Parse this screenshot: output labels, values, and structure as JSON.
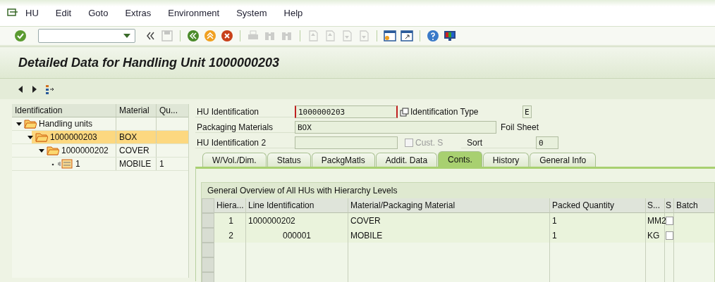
{
  "menu": [
    "HU",
    "Edit",
    "Goto",
    "Extras",
    "Environment",
    "System",
    "Help"
  ],
  "toolbar": [
    {
      "kind": "enter",
      "disabled": false
    },
    {
      "kind": "command-field"
    },
    {
      "kind": "collapse",
      "disabled": false
    },
    {
      "kind": "save",
      "disabled": true
    },
    {
      "kind": "sep"
    },
    {
      "kind": "back",
      "disabled": false
    },
    {
      "kind": "exit",
      "disabled": false
    },
    {
      "kind": "cancel",
      "disabled": false
    },
    {
      "kind": "sep"
    },
    {
      "kind": "print",
      "disabled": true
    },
    {
      "kind": "find",
      "disabled": true
    },
    {
      "kind": "find-next",
      "disabled": true
    },
    {
      "kind": "sep"
    },
    {
      "kind": "page-first",
      "disabled": true
    },
    {
      "kind": "page-up",
      "disabled": true
    },
    {
      "kind": "page-down",
      "disabled": true
    },
    {
      "kind": "page-last",
      "disabled": true
    },
    {
      "kind": "sep"
    },
    {
      "kind": "new-window",
      "disabled": false
    },
    {
      "kind": "shortcut",
      "disabled": false
    },
    {
      "kind": "sep"
    },
    {
      "kind": "help",
      "disabled": false
    },
    {
      "kind": "layout",
      "disabled": false
    }
  ],
  "title": "Detailed Data for Handling Unit 1000000203",
  "tree": {
    "columns": [
      "Identification",
      "Material",
      "Qu..."
    ],
    "nodes": [
      {
        "kind": "folder",
        "id": "Handling units",
        "selected": false,
        "expanded": true,
        "children": [
          {
            "kind": "folder",
            "id": "1000000203",
            "material": "BOX",
            "selected": true,
            "expanded": true,
            "children": [
              {
                "kind": "folder",
                "id": "1000000202",
                "material": "COVER",
                "selected": false,
                "expanded": true,
                "children": [
                  {
                    "kind": "item",
                    "id": "1",
                    "material": "MOBILE",
                    "quantity": "1",
                    "selected": false
                  }
                ]
              }
            ]
          }
        ]
      }
    ]
  },
  "header": {
    "hu_identification": {
      "label": "HU Identification",
      "value": "1000000203"
    },
    "identification_type": {
      "label": "Identification Type",
      "value": "E"
    },
    "packaging_materials": {
      "label": "Packaging Materials",
      "value": "BOX",
      "description": "Foil Sheet"
    },
    "hu_identification_2": {
      "label": "HU Identification 2"
    },
    "cust_s": {
      "label": "Cust. S",
      "checked": false,
      "disabled": true
    },
    "sort": {
      "label": "Sort",
      "value": "0"
    }
  },
  "tabs": [
    {
      "label": "W/Vol./Dim.",
      "selected": false
    },
    {
      "label": "Status",
      "selected": false
    },
    {
      "label": "PackgMatls",
      "selected": false
    },
    {
      "label": "Addit. Data",
      "selected": false
    },
    {
      "label": "Conts.",
      "selected": true
    },
    {
      "label": "History",
      "selected": false
    },
    {
      "label": "General Info",
      "selected": false
    }
  ],
  "contents": {
    "title": "General Overview of All HUs with Hierarchy Levels",
    "columns": [
      "Hiera...",
      "Line Identification",
      "Material/Packaging Material",
      "Packed Quantity",
      "S...",
      "S",
      "Batch"
    ],
    "rows": [
      {
        "kind": "hu",
        "hierarchy": "1",
        "line_id": "1000000202",
        "material": "COVER",
        "packed_quantity": "1",
        "unit": "MM2",
        "checked": false
      },
      {
        "kind": "item",
        "hierarchy": "2",
        "line_id": "000001",
        "material": "MOBILE",
        "packed_quantity": "1",
        "unit": "KG",
        "checked": false
      }
    ]
  }
}
